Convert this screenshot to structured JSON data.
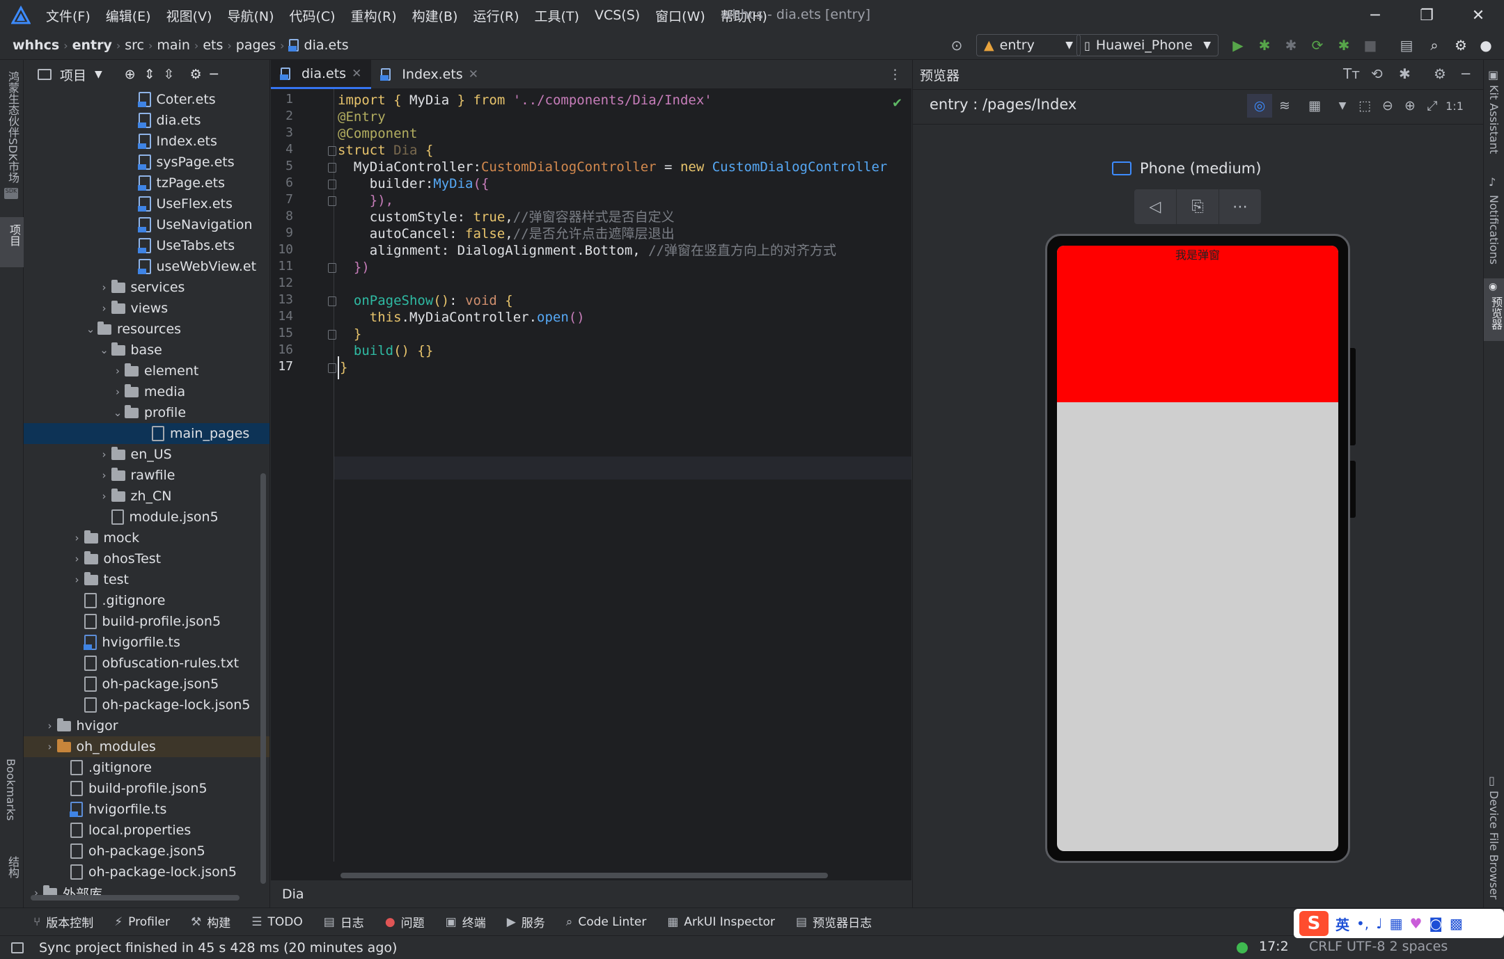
{
  "menubar": {
    "items": [
      "文件(F)",
      "编辑(E)",
      "视图(V)",
      "导航(N)",
      "代码(C)",
      "重构(R)",
      "构建(B)",
      "运行(R)",
      "工具(T)",
      "VCS(S)",
      "窗口(W)",
      "帮助(H)"
    ],
    "window_title": "whhcs - dia.ets [entry]"
  },
  "breadcrumb": [
    "whhcs",
    "entry",
    "src",
    "main",
    "ets",
    "pages",
    "dia.ets"
  ],
  "run": {
    "module": "entry",
    "device": "Huawei_Phone"
  },
  "project": {
    "label": "项目",
    "tree": [
      {
        "name": "Coter.ets",
        "kind": "ets",
        "depth": 7
      },
      {
        "name": "dia.ets",
        "kind": "ets",
        "depth": 7
      },
      {
        "name": "Index.ets",
        "kind": "ets",
        "depth": 7
      },
      {
        "name": "sysPage.ets",
        "kind": "ets",
        "depth": 7
      },
      {
        "name": "tzPage.ets",
        "kind": "ets",
        "depth": 7
      },
      {
        "name": "UseFlex.ets",
        "kind": "ets",
        "depth": 7
      },
      {
        "name": "UseNavigation",
        "kind": "ets",
        "depth": 7
      },
      {
        "name": "UseTabs.ets",
        "kind": "ets",
        "depth": 7
      },
      {
        "name": "useWebView.et",
        "kind": "ets",
        "depth": 7
      },
      {
        "name": "services",
        "kind": "folder",
        "depth": 5,
        "chev": "›"
      },
      {
        "name": "views",
        "kind": "folder",
        "depth": 5,
        "chev": "›"
      },
      {
        "name": "resources",
        "kind": "folder",
        "depth": 4,
        "chev": "⌄"
      },
      {
        "name": "base",
        "kind": "folder",
        "depth": 5,
        "chev": "⌄"
      },
      {
        "name": "element",
        "kind": "folder",
        "depth": 6,
        "chev": "›"
      },
      {
        "name": "media",
        "kind": "folder",
        "depth": 6,
        "chev": "›"
      },
      {
        "name": "profile",
        "kind": "folder",
        "depth": 6,
        "chev": "⌄"
      },
      {
        "name": "main_pages",
        "kind": "cfg",
        "depth": 8,
        "selected": true
      },
      {
        "name": "en_US",
        "kind": "folder",
        "depth": 5,
        "chev": "›"
      },
      {
        "name": "rawfile",
        "kind": "folder",
        "depth": 5,
        "chev": "›"
      },
      {
        "name": "zh_CN",
        "kind": "folder",
        "depth": 5,
        "chev": "›"
      },
      {
        "name": "module.json5",
        "kind": "cfg",
        "depth": 5
      },
      {
        "name": "mock",
        "kind": "folder",
        "depth": 3,
        "chev": "›"
      },
      {
        "name": "ohosTest",
        "kind": "folder",
        "depth": 3,
        "chev": "›"
      },
      {
        "name": "test",
        "kind": "folder",
        "depth": 3,
        "chev": "›"
      },
      {
        "name": ".gitignore",
        "kind": "cfg",
        "depth": 3
      },
      {
        "name": "build-profile.json5",
        "kind": "cfg",
        "depth": 3
      },
      {
        "name": "hvigorfile.ts",
        "kind": "ts",
        "depth": 3
      },
      {
        "name": "obfuscation-rules.txt",
        "kind": "cfg",
        "depth": 3
      },
      {
        "name": "oh-package.json5",
        "kind": "cfg",
        "depth": 3
      },
      {
        "name": "oh-package-lock.json5",
        "kind": "cfg",
        "depth": 3
      },
      {
        "name": "hvigor",
        "kind": "folder",
        "depth": 1,
        "chev": "›"
      },
      {
        "name": "oh_modules",
        "kind": "folder-orange",
        "depth": 1,
        "chev": "›",
        "highlight": true
      },
      {
        "name": ".gitignore",
        "kind": "cfg",
        "depth": 2
      },
      {
        "name": "build-profile.json5",
        "kind": "cfg",
        "depth": 2
      },
      {
        "name": "hvigorfile.ts",
        "kind": "ts",
        "depth": 2
      },
      {
        "name": "local.properties",
        "kind": "cfg",
        "depth": 2
      },
      {
        "name": "oh-package.json5",
        "kind": "cfg",
        "depth": 2
      },
      {
        "name": "oh-package-lock.json5",
        "kind": "cfg",
        "depth": 2
      },
      {
        "name": "外部库",
        "kind": "lib",
        "depth": 0,
        "chev": "›"
      }
    ]
  },
  "editor": {
    "tabs": [
      {
        "label": "dia.ets",
        "active": true
      },
      {
        "label": "Index.ets",
        "active": false
      }
    ],
    "line_numbers": [
      "1",
      "2",
      "3",
      "4",
      "5",
      "6",
      "7",
      "8",
      "9",
      "10",
      "11",
      "12",
      "13",
      "14",
      "15",
      "16",
      "17"
    ],
    "current_line": "17",
    "bottom_crumb": "Dia"
  },
  "code": {
    "l1": {
      "import": "import",
      "lb": "{",
      "name": " MyDia ",
      "rb": "}",
      "from": "from",
      "path": "'../components/Dia/Index'"
    },
    "l2": "@Entry",
    "l3": "@Component",
    "l4": {
      "struct": "struct",
      "name": "Dia",
      "brace": "{"
    },
    "l5": {
      "prop": "MyDiaController",
      "colon": ":",
      "type": "CustomDialogController",
      "eq": " = ",
      "new": "new",
      "ctor": "CustomDialogController"
    },
    "l6": {
      "prop": "builder",
      "colon": ":",
      "fn": "MyDia",
      "paren": "({"
    },
    "l7": "}),",
    "l8": {
      "prop": "customStyle",
      "colon": ": ",
      "val": "true",
      "comma": ",",
      "comment": "//弹窗容器样式是否自定义"
    },
    "l9": {
      "prop": "autoCancel",
      "colon": ": ",
      "val": "false",
      "comma": ",",
      "comment": "//是否允许点击遮障层退出"
    },
    "l10": {
      "prop": "alignment",
      "colon": ": ",
      "val": "DialogAlignment.Bottom",
      "comma": ", ",
      "comment": "//弹窗在竖直方向上的对齐方式"
    },
    "l11": "})",
    "l13": {
      "fn": "onPageShow",
      "paren": "()",
      "colon": ": ",
      "type": "void",
      "brace": " {"
    },
    "l14": {
      "this": "this",
      "dot": ".",
      "prop": "MyDiaController",
      "dot2": ".",
      "fn": "open",
      "paren": "()"
    },
    "l15": "}",
    "l16": {
      "fn": "build",
      "paren": "()",
      "brace": " {}"
    },
    "l17": "}"
  },
  "preview": {
    "title": "预览器",
    "path": "entry : /pages/Index",
    "device": "Phone (medium)",
    "dialog_text": "我是弹窗",
    "colors": {
      "dialog": "#ff0000",
      "screen": "#cfcfcf"
    }
  },
  "left_strip": {
    "top": "鸿蒙生态伙伴SDK市场",
    "project": "项目",
    "bookmarks": "Bookmarks",
    "structure": "结构"
  },
  "right_strip": {
    "kit": "Kit Assistant",
    "notifications": "Notifications",
    "preview": "预览器",
    "device_files": "Device File Browser"
  },
  "toolbar": {
    "items": [
      "版本控制",
      "Profiler",
      "构建",
      "TODO",
      "日志",
      "问题",
      "终端",
      "服务",
      "Code Linter",
      "ArkUI Inspector",
      "预览器日志"
    ]
  },
  "status": {
    "message": "Sync project finished in 45 s 428 ms (20 minutes ago)",
    "position": "17:2",
    "rest": "CRLF   UTF-8   2 spaces"
  },
  "ime": {
    "lang": "英"
  }
}
